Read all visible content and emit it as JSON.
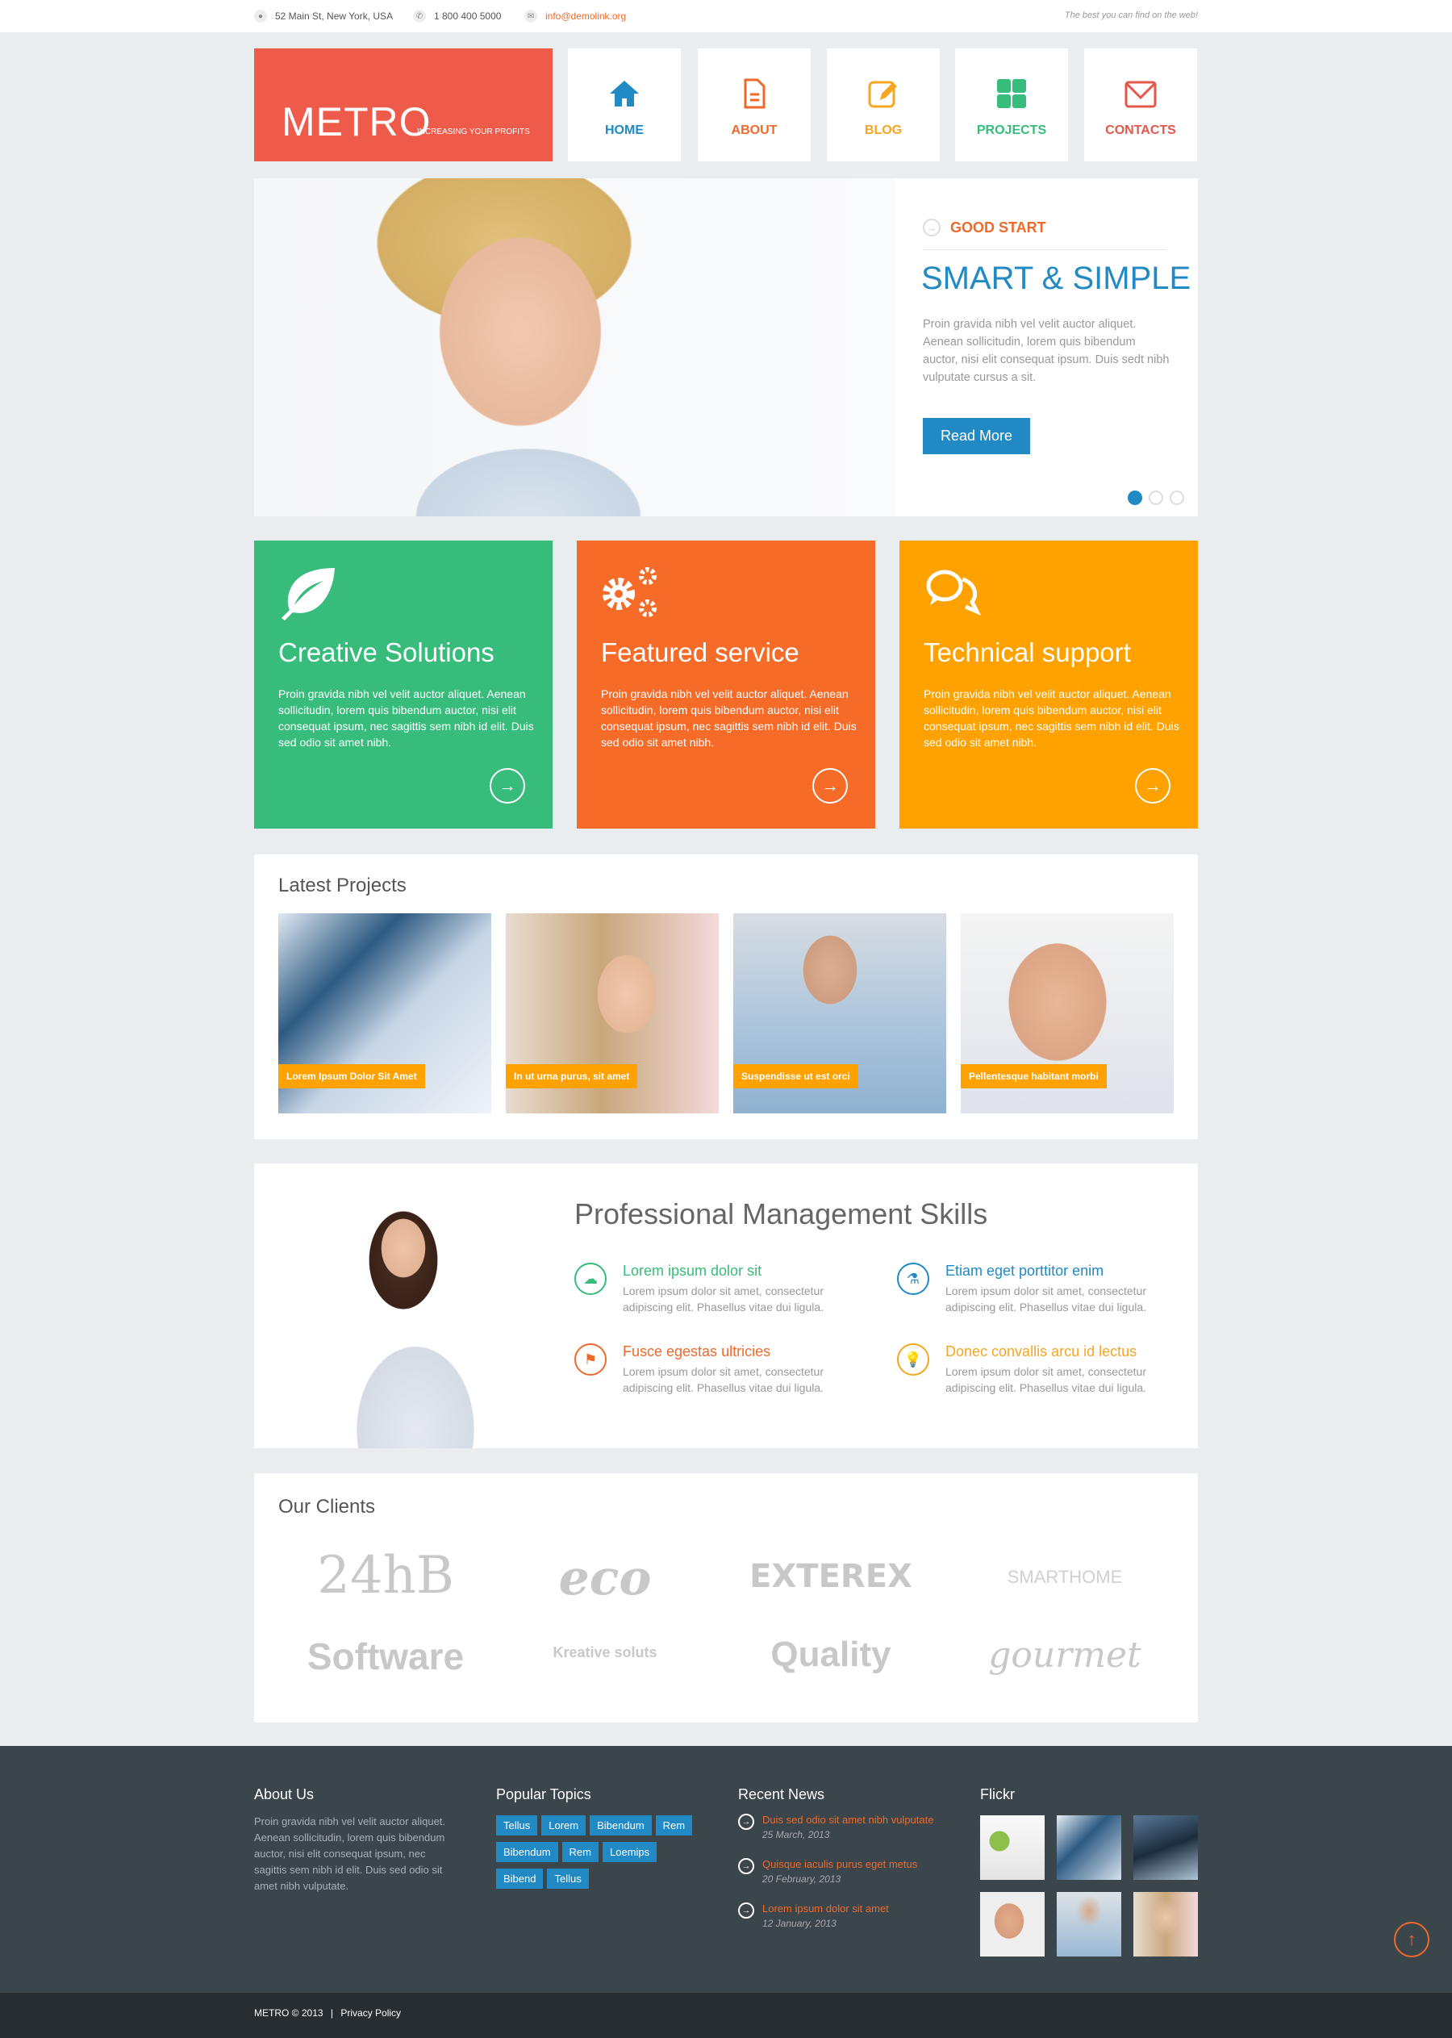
{
  "topbar": {
    "address": "52 Main St, New York, USA",
    "phone": "1 800 400 5000",
    "email": "info@demolink.org",
    "slogan": "The best you can find on the web!"
  },
  "logo": {
    "name": "METRO",
    "tagline": "INCREASING YOUR PROFITS"
  },
  "nav": [
    {
      "label": "HOME",
      "icon": "home-icon",
      "color": "#2189c3"
    },
    {
      "label": "ABOUT",
      "icon": "document-icon",
      "color": "#ee6a2b"
    },
    {
      "label": "BLOG",
      "icon": "edit-icon",
      "color": "#f5a623"
    },
    {
      "label": "PROJECTS",
      "icon": "grid-icon",
      "color": "#37bc7b"
    },
    {
      "label": "CONTACTS",
      "icon": "envelope-icon",
      "color": "#e5574b"
    }
  ],
  "slider": {
    "kicker": "GOOD START",
    "title": "SMART & SIMPLE",
    "text": "Proin gravida nibh vel velit auctor aliquet. Aenean sollicitudin, lorem quis bibendum auctor, nisi elit consequat ipsum. Duis sedt nibh vulputate cursus a sit.",
    "button": "Read More",
    "active_slide": 1,
    "slide_count": 3
  },
  "services": [
    {
      "title": "Creative Solutions",
      "icon": "leaf-icon",
      "color": "#37bc7b",
      "text": "Proin gravida nibh vel velit auctor aliquet. Aenean sollicitudin, lorem quis bibendum auctor, nisi elit consequat ipsum, nec sagittis sem nibh id elit. Duis sed odio sit amet nibh."
    },
    {
      "title": "Featured service",
      "icon": "gears-icon",
      "color": "#f76b28",
      "text": "Proin gravida nibh vel velit auctor aliquet. Aenean sollicitudin, lorem quis bibendum auctor, nisi elit consequat ipsum, nec sagittis sem nibh id elit. Duis sed odio sit amet nibh."
    },
    {
      "title": "Technical support",
      "icon": "chat-icon",
      "color": "#ffa200",
      "text": "Proin gravida nibh vel velit auctor aliquet. Aenean sollicitudin, lorem quis bibendum auctor, nisi elit consequat ipsum, nec sagittis sem nibh id elit. Duis sed odio sit amet nibh."
    }
  ],
  "projects": {
    "title": "Latest Projects",
    "items": [
      "Lorem Ipsum Dolor Sit Amet",
      "In ut urna purus, sit amet",
      "Suspendisse ut est orci",
      "Pellentesque habitant morbi"
    ]
  },
  "skills": {
    "title": "Professional Management Skills",
    "items": [
      {
        "title": "Lorem ipsum dolor sit",
        "icon": "cloud-download-icon",
        "color": "#37bc7b",
        "text": "Lorem ipsum dolor sit amet, consectetur adipiscing elit. Phasellus vitae dui ligula."
      },
      {
        "title": "Etiam eget porttitor enim",
        "icon": "flask-icon",
        "color": "#2189c3",
        "text": "Lorem ipsum dolor sit amet, consectetur adipiscing elit. Phasellus vitae dui ligula."
      },
      {
        "title": "Fusce egestas ultricies",
        "icon": "flag-icon",
        "color": "#ee6a2b",
        "text": "Lorem ipsum dolor sit amet, consectetur adipiscing elit. Phasellus vitae dui ligula."
      },
      {
        "title": "Donec convallis arcu id lectus",
        "icon": "lightbulb-icon",
        "color": "#f5a623",
        "text": "Lorem ipsum dolor sit amet, consectetur adipiscing elit. Phasellus vitae dui ligula."
      }
    ]
  },
  "clients": {
    "title": "Our Clients",
    "logos": [
      "24hB",
      "eco",
      "EXTEREX",
      "SMARTHOME",
      "Software",
      "Kreative soluts",
      "Quality",
      "gourmet"
    ]
  },
  "footer": {
    "about_title": "About Us",
    "about_text": "Proin gravida nibh vel velit auctor aliquet. Aenean sollicitudin, lorem quis bibendum auctor, nisi elit consequat ipsum, nec sagittis sem nibh id elit. Duis sed odio sit amet nibh vulputate.",
    "topics_title": "Popular Topics",
    "topics": [
      "Tellus",
      "Lorem",
      "Bibendum",
      "Rem",
      "Bibendum",
      "Rem",
      "Loemips",
      "Bibend",
      "Tellus"
    ],
    "news_title": "Recent News",
    "news": [
      {
        "title": "Duis sed odio sit amet nibh vulputate",
        "date": "25 March, 2013"
      },
      {
        "title": "Quisque iaculis purus eget metus",
        "date": "20 February, 2013"
      },
      {
        "title": "Lorem ipsum dolor sit amet",
        "date": "12 January, 2013"
      }
    ],
    "flickr_title": "Flickr"
  },
  "bottom": {
    "copyright": "METRO © 2013",
    "separator": "|",
    "privacy": "Privacy Policy"
  }
}
